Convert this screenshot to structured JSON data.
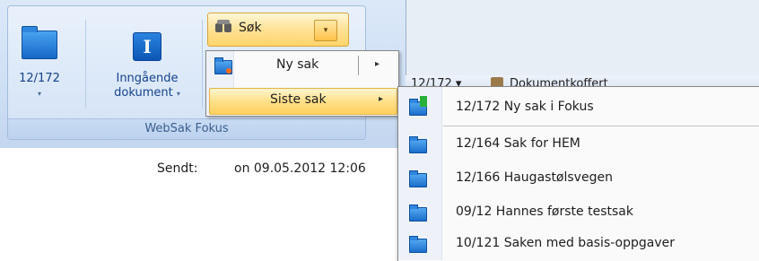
{
  "ribbon": {
    "group_label": "WebSak Fokus",
    "case_button": {
      "label": "12/172",
      "icon": "folder-icon",
      "caret": "▾"
    },
    "incoming_button": {
      "label_line1": "Inngående",
      "label_line2": "dokument",
      "caret": "▾",
      "icon": "info-icon"
    },
    "search": {
      "label": "Søk",
      "icon": "binoculars-icon",
      "dropdown_glyph": "▾"
    }
  },
  "menu": {
    "items": [
      {
        "label": "Ny sak",
        "arrow": "▸"
      },
      {
        "label": "Siste sak",
        "arrow": "▸"
      }
    ]
  },
  "submenu": {
    "items": [
      {
        "label": "12/172 Ny sak i Fokus",
        "icon": "new-case-icon"
      },
      {
        "label": "12/164 Sak for HEM",
        "icon": "folder-icon"
      },
      {
        "label": "12/166 Haugastølsvegen",
        "icon": "folder-icon"
      },
      {
        "label": "09/12 Hannes første testsak",
        "icon": "folder-icon"
      },
      {
        "label": "10/121 Saken med basis-oppgaver",
        "icon": "folder-icon"
      }
    ]
  },
  "background": {
    "partial_case": "12/172 ▾",
    "partial_doc": "Dokumentkoffert"
  },
  "message": {
    "sent_label": "Sendt:",
    "sent_value": "on 09.05.2012 12:06"
  },
  "colors": {
    "ribbon_text": "#15428b",
    "highlight": "#ffe08a",
    "folder_blue": "#1569c7"
  }
}
